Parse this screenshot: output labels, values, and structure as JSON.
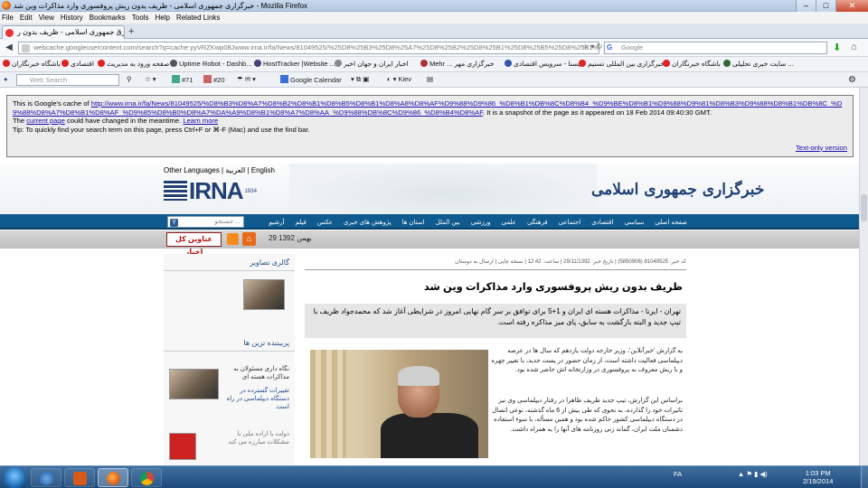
{
  "window": {
    "title": "خبرگزاری جمهوری اسلامی - ظریف بدون ریش پروفسوری وارد مذاکرات وین شد - Mozilla Firefox"
  },
  "menu": [
    "File",
    "Edit",
    "View",
    "History",
    "Bookmarks",
    "Tools",
    "Help",
    "Related Links"
  ],
  "tab": {
    "label": "خبرگزاری جمهوری اسلامی - ظریف بدون ر...",
    "new_tab": "+"
  },
  "nav": {
    "url": "webcache.googleusercontent.com/search?q=cache:yyVRZKwp08Jwww.irna.ir/fa/News/81049525/%25D8%25B3%25D8%25A7%25D8%25B2%25D8%25B1%25D8%25B5%25D8%25B1%25D8",
    "search_placeholder": "Google",
    "search_engine": "G"
  },
  "bookmarks": [
    "سایت خبری تحلیلی ...",
    "باشگاه خبرنگاران",
    "خبرگزاری بین المللی تسنیم",
    "ایسنا - سرویس اقتصادی",
    "Mehr ... خبرگزاری مهر",
    "اخبار ایران و جهان اخبر",
    "HostTracker |Website ...",
    "Uptime Robot - Dashb...",
    "صفحه ورود به مدیریت",
    "اقتصادی",
    "باشگاه خبرنگاران"
  ],
  "toolbar2": {
    "web_search_placeholder": "Web Search",
    "badge1": "#71",
    "badge2": "#20",
    "calendar": "Google Calendar",
    "kiev": "Kiev"
  },
  "cache_notice": {
    "line1_prefix": "This is Google's cache of",
    "url": "http://www.irna.ir/fa/News/81049525/%D8%B3%D8%A7%D8%B2%D8%B1%D8%B5%D8%B1%D8%A8%D8%AF%D9%88%D9%86_%D8%B1%DB%8C%D8%B4_%D9%BE%D8%B1%D9%88%D9%81%D8%B3%D9%88%D8%B1%DB%8C_%D9%88%D8%A7%D8%B1%D8%AF_%D9%85%D8%B0%D8%A7%DA%A9%D8%B1%D8%A7%D8%AA_%D9%88%DB%8C%D9%86_%D8%B4%D8%AF",
    "line1_suffix": ". It is a snapshot of the page as it appeared on 18 Feb 2014 09:40:30 GMT.",
    "line2_a": "The",
    "current_page": "current page",
    "line2_b": "could have changed in the meantime.",
    "learn_more": "Learn more",
    "tip": "Tip: To quickly find your search term on this page, press Ctrl+F or ⌘-F (Mac) and use the find bar.",
    "text_only": "Text-only version"
  },
  "site": {
    "langs": "Other Languages | العربية | English",
    "logo_en": "IRNA",
    "logo_year": "1934",
    "logo_fa": "خبرگزاری جمهوری اسلامی",
    "search_placeholder": "جستجو ...",
    "nav": [
      "صفحه اصلی",
      "سیاسی",
      "اقتصادی",
      "اجتماعی",
      "فرهنگی",
      "علمی",
      "ورزشی",
      "بین الملل",
      "استان ها",
      "پژوهش های خبری",
      "عکس",
      "فیلم",
      "آرشیو"
    ],
    "headlines_btn": "عناوین کل اخبار",
    "date": "29 بهمن 1392"
  },
  "sidebar": {
    "gallery_title": "گالری تصاویر",
    "popular_title": "پربیننده ترین ها",
    "item1": "نگاه داری مسئولان به مذاکرات هسته ای",
    "item2": "تغییرات گسترده در دستگاه دیپلماسی در راه است",
    "item3": "دولت با اراده ملی با مشکلات مبارزه می کند"
  },
  "article": {
    "meta": "کد خبر: 81049525 (5850906) | تاریخ خبر: 29/11/1392 | ساعت: 12:42 | نسخه چاپی | ارسال به دوستان",
    "headline": "ظریف بدون ریش پروفسوری وارد مذاکرات وین شد",
    "lead": "تهران - ایرنا - مذاکرات هسته ای ایران و 1+5 برای توافق بر سر گام نهایی امروز در شرایطی آغاز شد که محمدجواد ظریف با تیپ جدید و البته بازگشت به سابق، پای میز مذاکره رفته است.",
    "p1": "به گزارش 'خبرآنلاین'، وزیر خارجه دولت یازدهم که سال ها در عرصه دیپلماسی فعالیت داشته است، از زمان حضور در پست جدید، با تغییر چهره و با ریش معروف به پروفسوری در وزارتخانه اش حاضر شده بود.",
    "p2": "براساس این گزارش، تیپ جدید ظریف ظاهرا در رفتار دیپلماسی وی نیز تاثیرات خود را گذارده، به نحوی که طی بیش از 6 ماه گذشته، نوعی اتصال در دستگاه دیپلماسی کشور حاکم شده بود و همین مسأله، با سوء استفاده دشمنان ملت ایران، گمانه زنی روزنامه های آنها را به همراه داشت."
  },
  "taskbar": {
    "lang": "FA",
    "time": "1:03 PM",
    "date": "2/19/2014"
  }
}
